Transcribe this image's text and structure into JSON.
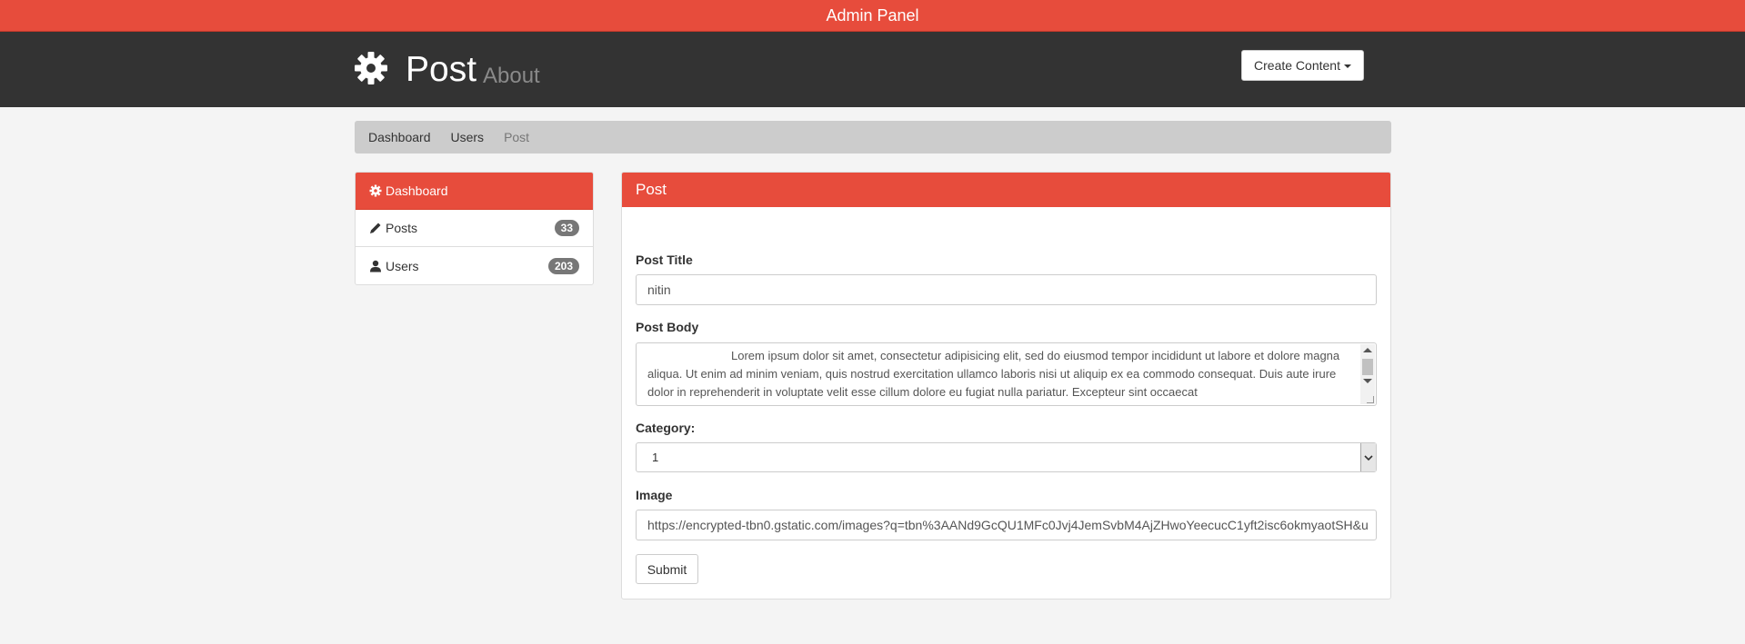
{
  "topbar": {
    "title": "Admin Panel"
  },
  "header": {
    "title": "Post",
    "subtitle": "About",
    "create_button": "Create Content",
    "icon": "gear-icon"
  },
  "breadcrumb": {
    "items": [
      {
        "label": "Dashboard",
        "active": false
      },
      {
        "label": "Users",
        "active": false
      },
      {
        "label": "Post",
        "active": true
      }
    ]
  },
  "sidebar": {
    "items": [
      {
        "label": "Dashboard",
        "icon": "gear-icon",
        "active": true
      },
      {
        "label": "Posts",
        "icon": "pencil-icon",
        "badge": "33"
      },
      {
        "label": "Users",
        "icon": "user-icon",
        "badge": "203"
      }
    ]
  },
  "panel": {
    "title": "Post",
    "post_title_label": "Post Title",
    "post_title_value": "nitin",
    "post_body_label": "Post Body",
    "post_body_value": "Lorem ipsum dolor sit amet, consectetur adipisicing elit, sed do eiusmod tempor incididunt ut labore et dolore magna aliqua. Ut enim ad minim veniam, quis nostrud exercitation ullamco laboris nisi ut aliquip ex ea commodo consequat. Duis aute irure dolor in reprehenderit in voluptate velit esse cillum dolore eu fugiat nulla pariatur. Excepteur sint occaecat",
    "category_label": "Category:",
    "category_value": "1",
    "image_label": "Image",
    "image_value": "https://encrypted-tbn0.gstatic.com/images?q=tbn%3AANd9GcQU1MFc0Jvj4JemSvbM4AjZHwoYeecucC1yft2isc6okmyaotSH&u",
    "submit_label": "Submit"
  },
  "colors": {
    "accent": "#e74c3c",
    "header_bg": "#333333",
    "breadcrumb_bg": "#cccccc",
    "badge_bg": "#777777"
  }
}
